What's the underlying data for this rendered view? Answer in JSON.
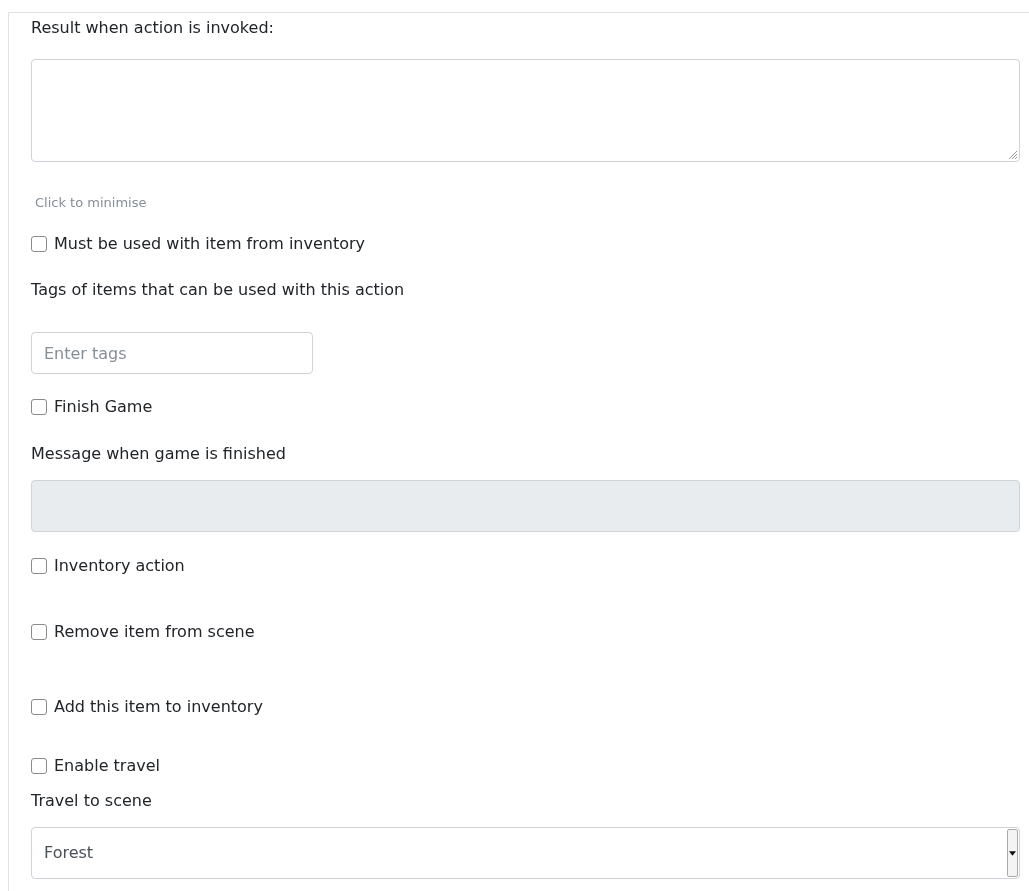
{
  "form": [
    {
      "kind": "label",
      "text": "Result when action is invoked:"
    },
    {
      "kind": "textarea",
      "disabled": false
    },
    {
      "kind": "hint",
      "text": "Click to minimise"
    },
    {
      "kind": "checkbox",
      "label": "Must be used with item from inventory",
      "checked": false
    },
    {
      "kind": "label",
      "text": "Tags of items that can be used with this action"
    },
    {
      "kind": "tags_input",
      "placeholder": "Enter tags",
      "disabled": false
    },
    {
      "kind": "checkbox",
      "label": "Finish Game",
      "checked": false
    },
    {
      "kind": "label",
      "text": "Message when game is finished"
    },
    {
      "kind": "text_input",
      "disabled": true
    },
    {
      "kind": "checkbox",
      "label": "Inventory action",
      "checked": false
    },
    {
      "kind": "checkbox",
      "label": "Remove item from scene",
      "checked": false
    },
    {
      "kind": "checkbox",
      "label": "Add this item to inventory",
      "checked": false
    },
    {
      "kind": "checkbox",
      "label": "Enable travel",
      "checked": false
    },
    {
      "kind": "label",
      "text": "Travel to scene"
    },
    {
      "kind": "select",
      "value": "Forest"
    }
  ]
}
